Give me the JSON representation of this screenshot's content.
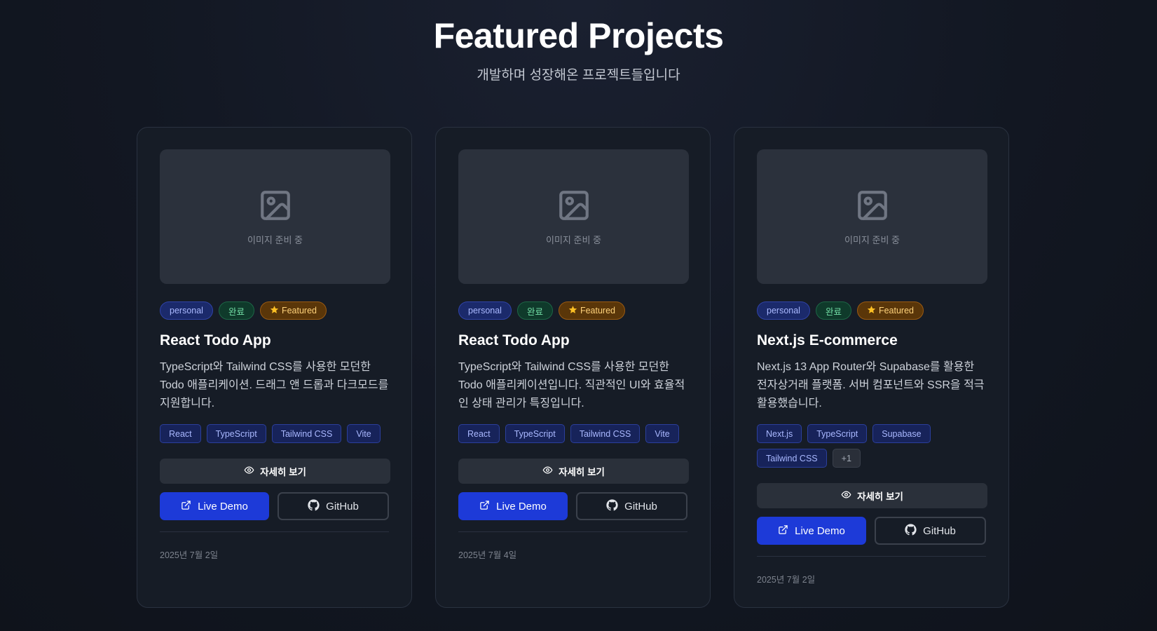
{
  "header": {
    "title": "Featured Projects",
    "subtitle": "개발하며 성장해온 프로젝트들입니다"
  },
  "cards": [
    {
      "thumb_text": "이미지 준비 중",
      "category": "personal",
      "status": "완료",
      "featured": "Featured",
      "title": "React Todo App",
      "description": "TypeScript와 Tailwind CSS를 사용한 모던한 Todo 애플리케이션. 드래그 앤 드롭과 다크모드를 지원합니다.",
      "tags": [
        "React",
        "TypeScript",
        "Tailwind CSS",
        "Vite"
      ],
      "detail_label": "자세히 보기",
      "live_label": "Live Demo",
      "github_label": "GitHub",
      "date": "2025년 7월 2일"
    },
    {
      "thumb_text": "이미지 준비 중",
      "category": "personal",
      "status": "완료",
      "featured": "Featured",
      "title": "React Todo App",
      "description": "TypeScript와 Tailwind CSS를 사용한 모던한 Todo 애플리케이션입니다. 직관적인 UI와 효율적인 상태 관리가 특징입니다.",
      "tags": [
        "React",
        "TypeScript",
        "Tailwind CSS",
        "Vite"
      ],
      "detail_label": "자세히 보기",
      "live_label": "Live Demo",
      "github_label": "GitHub",
      "date": "2025년 7월 4일"
    },
    {
      "thumb_text": "이미지 준비 중",
      "category": "personal",
      "status": "완료",
      "featured": "Featured",
      "title": "Next.js E-commerce",
      "description": "Next.js 13 App Router와 Supabase를 활용한 전자상거래 플랫폼. 서버 컴포넌트와 SSR을 적극 활용했습니다.",
      "tags": [
        "Next.js",
        "TypeScript",
        "Supabase",
        "Tailwind CSS"
      ],
      "tag_more": "+1",
      "detail_label": "자세히 보기",
      "live_label": "Live Demo",
      "github_label": "GitHub",
      "date": "2025년 7월 2일"
    }
  ],
  "icons": {
    "thumb": "image-placeholder-icon",
    "featured": "star-icon",
    "detail": "eye-icon",
    "live": "external-link-icon",
    "github": "github-icon"
  },
  "colors": {
    "accent": "#1d3ad8",
    "category_badge": "#1b2a6b",
    "status_badge": "#0f3a2b",
    "featured_badge": "#5a3609"
  }
}
